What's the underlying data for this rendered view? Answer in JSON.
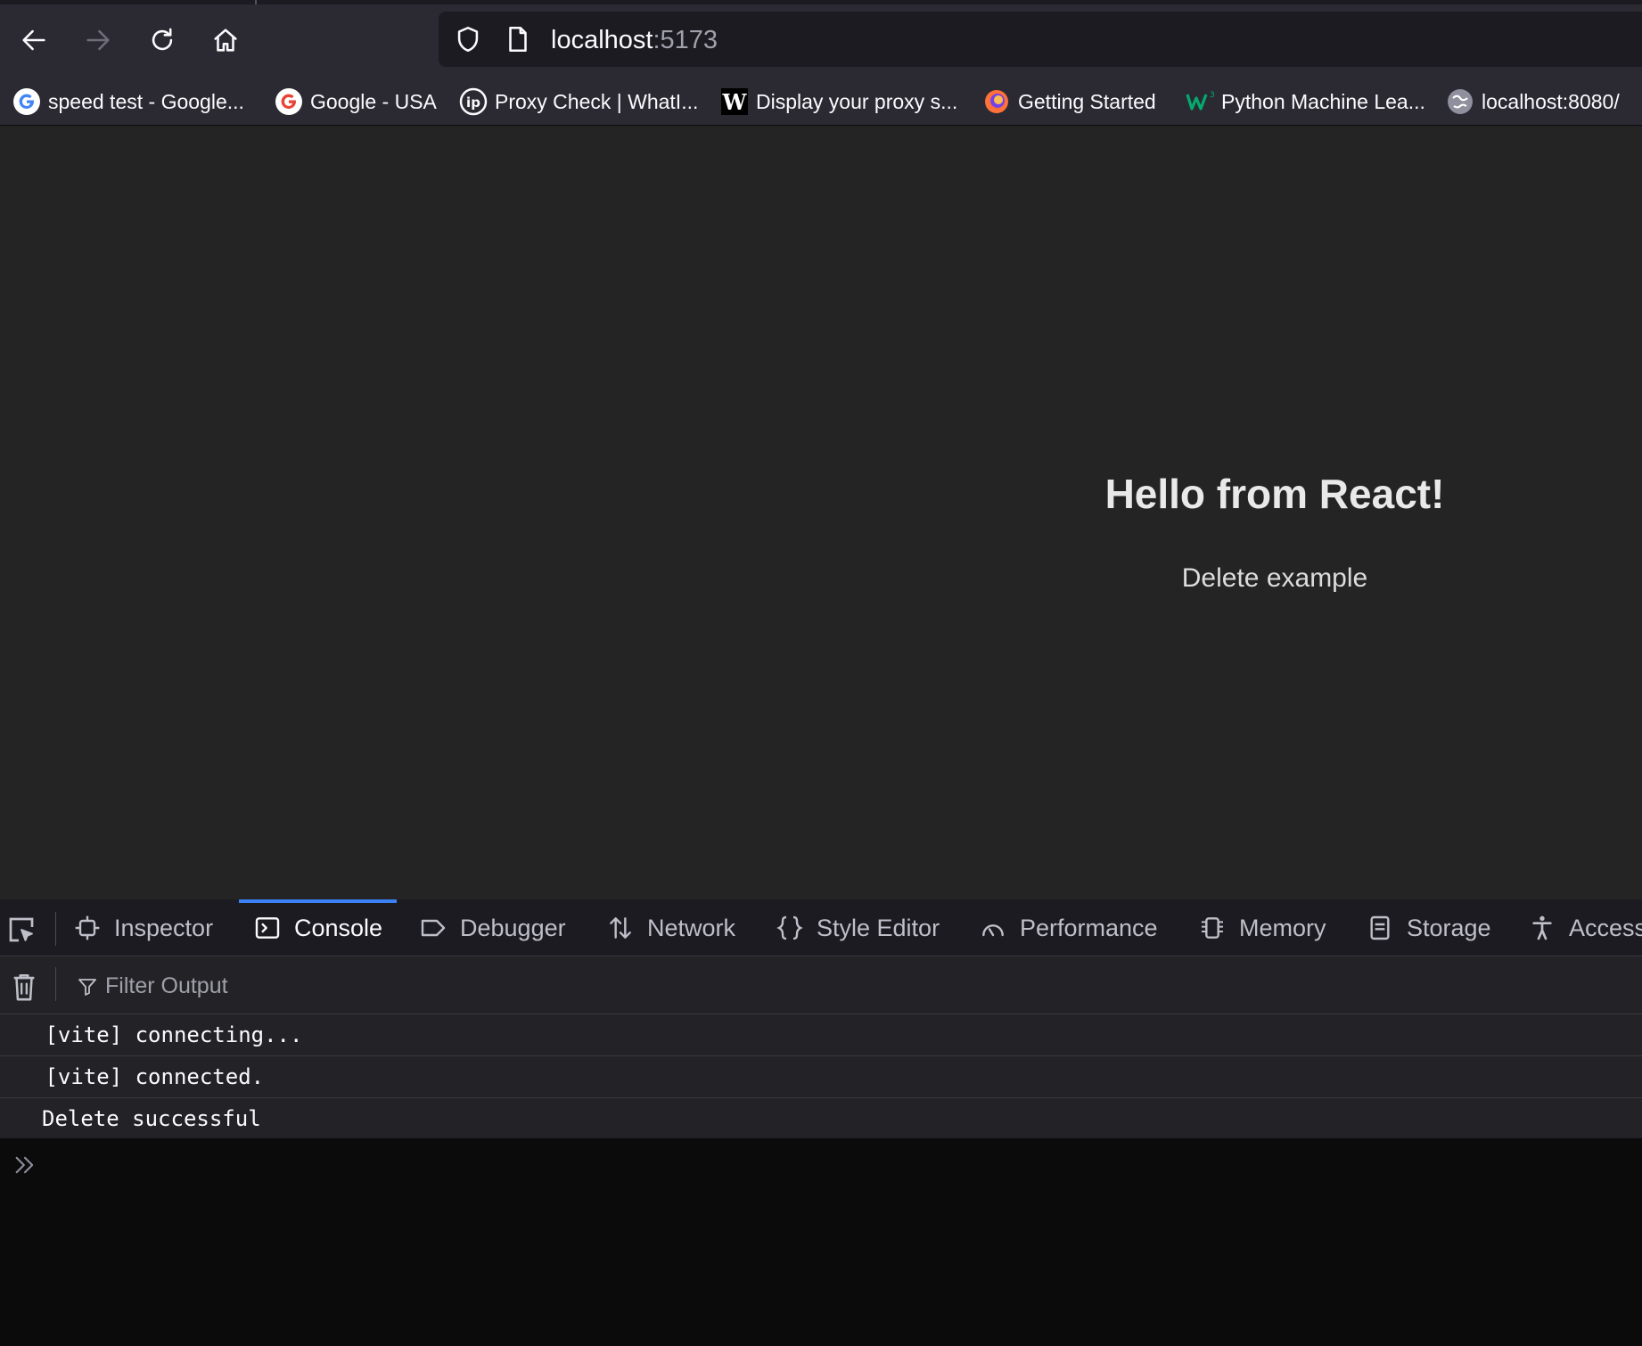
{
  "browser": {
    "url_host": "localhost",
    "url_port": ":5173",
    "bookmarks": [
      {
        "label": "speed test - Google...",
        "icon": "google-icon"
      },
      {
        "label": "Google - USA",
        "icon": "google-icon"
      },
      {
        "label": "Proxy Check | WhatI...",
        "icon": "ip-icon"
      },
      {
        "label": "Display your proxy s...",
        "icon": "w-icon"
      },
      {
        "label": "Getting Started",
        "icon": "firefox-icon"
      },
      {
        "label": "Python Machine Lea...",
        "icon": "w3-icon"
      },
      {
        "label": "localhost:8080/",
        "icon": "globe-icon"
      }
    ]
  },
  "page": {
    "heading": "Hello from React!",
    "subtitle": "Delete example"
  },
  "devtools": {
    "tabs": [
      {
        "label": "Inspector",
        "icon": "inspector-icon",
        "active": false
      },
      {
        "label": "Console",
        "icon": "console-icon",
        "active": true
      },
      {
        "label": "Debugger",
        "icon": "debugger-icon",
        "active": false
      },
      {
        "label": "Network",
        "icon": "network-icon",
        "active": false
      },
      {
        "label": "Style Editor",
        "icon": "style-editor-icon",
        "active": false
      },
      {
        "label": "Performance",
        "icon": "performance-icon",
        "active": false
      },
      {
        "label": "Memory",
        "icon": "memory-icon",
        "active": false
      },
      {
        "label": "Storage",
        "icon": "storage-icon",
        "active": false
      },
      {
        "label": "Access",
        "icon": "accessibility-icon",
        "active": false
      }
    ],
    "filter_placeholder": "Filter Output",
    "logs": [
      " [vite] connecting...",
      " [vite] connected.",
      "Delete successful"
    ]
  },
  "colors": {
    "toolbar_bg": "#2b2a33",
    "page_bg": "#242424",
    "devtools_accent": "#3b82f6"
  }
}
